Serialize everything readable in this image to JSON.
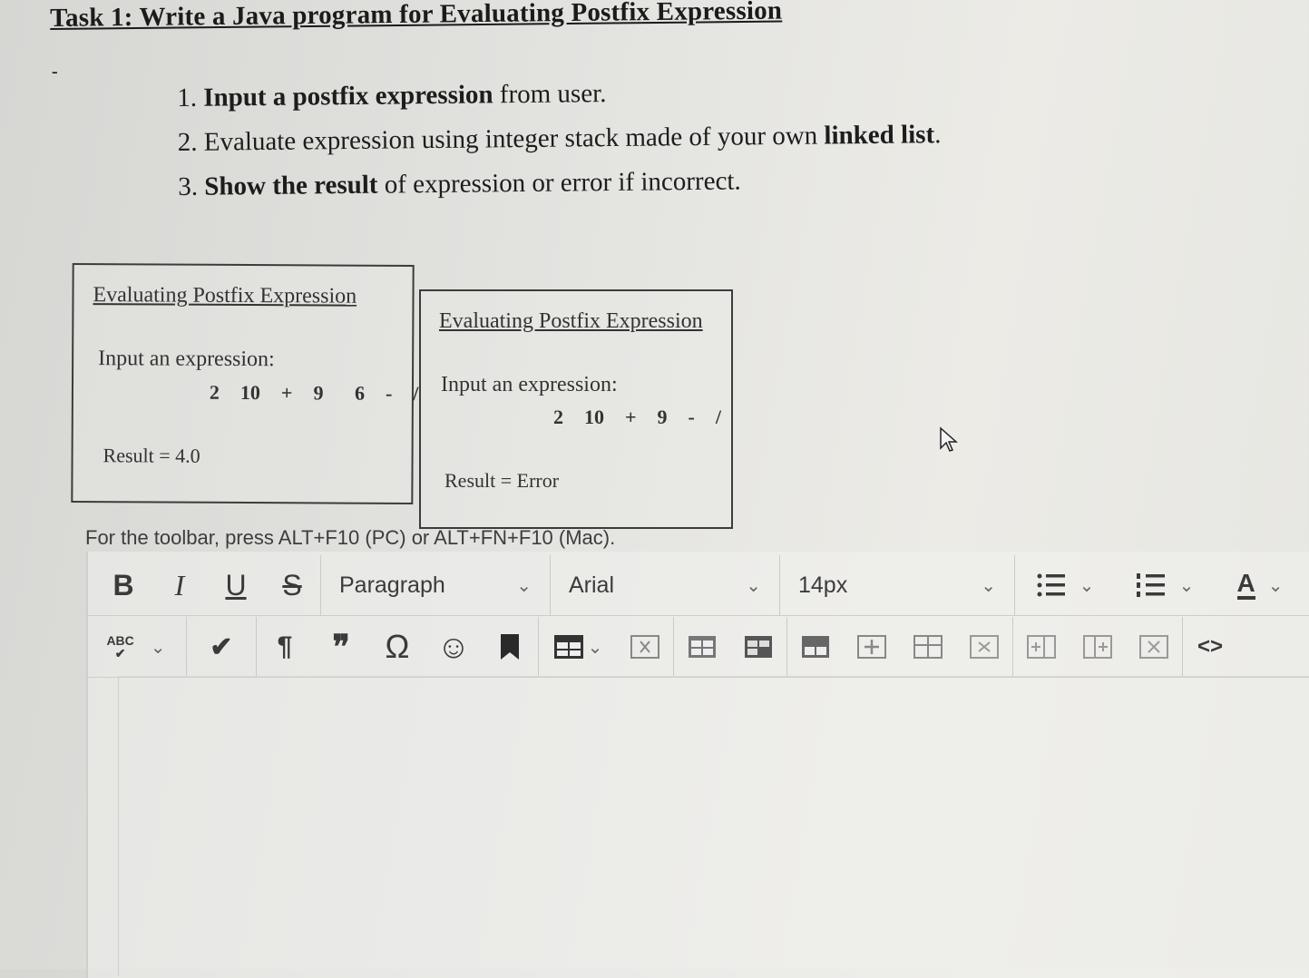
{
  "task": {
    "title": "Task 1:  Write a Java program for Evaluating Postfix Expression",
    "dash": "-",
    "steps": [
      {
        "num": "1.",
        "bold": "Input a postfix expression",
        "rest": " from user."
      },
      {
        "num": "2.",
        "pre": "Evaluate expression using integer stack made of your own ",
        "bold": "linked list",
        "rest": "."
      },
      {
        "num": "3.",
        "bold": "Show the result",
        "rest": " of expression or error if incorrect."
      }
    ]
  },
  "examples": [
    {
      "title": "Evaluating Postfix Expression",
      "prompt": "Input an expression:",
      "expression": "2  10  +  9   6  -  /",
      "result": "Result =  4.0"
    },
    {
      "title": "Evaluating Postfix Expression",
      "prompt": "Input an expression:",
      "expression": "2  10  +  9  -  /",
      "result": "Result =  Error"
    }
  ],
  "editor": {
    "hint": "For the toolbar, press ALT+F10 (PC) or ALT+FN+F10 (Mac).",
    "bold": "B",
    "italic": "I",
    "underline": "U",
    "strike": "S",
    "block_format": "Paragraph",
    "font_family": "Arial",
    "font_size": "14px",
    "font_color_glyph": "A",
    "spellcheck_glyph": "ABC",
    "paragraph_glyph": "¶",
    "quote_glyph": "❞",
    "omega_glyph": "Ω",
    "emoji_glyph": "☺",
    "code_glyph": "<>",
    "chevron": "⌄"
  },
  "colors": {
    "text": "#1d1d1d",
    "toolbar_icon": "#3a3a3a",
    "border": "#3c3c3c"
  }
}
